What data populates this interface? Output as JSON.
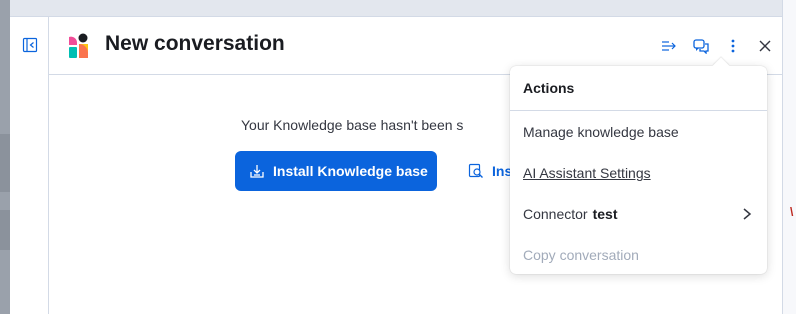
{
  "header": {
    "title": "New conversation"
  },
  "body": {
    "message": "Your Knowledge base hasn't been s",
    "install_label": "Install Knowledge base",
    "inspect_label": "Ins"
  },
  "actions_menu": {
    "title": "Actions",
    "items": [
      {
        "label": "Manage knowledge base"
      },
      {
        "label": "AI Assistant Settings"
      },
      {
        "label": "Connector",
        "value": "test"
      },
      {
        "label": "Copy conversation"
      }
    ]
  },
  "colors": {
    "primary": "#0b64dd",
    "text": "#343741",
    "disabled": "#a2abba",
    "border": "#d3dae6"
  },
  "icons": {
    "rail": "sidebar-collapse-icon",
    "header": [
      "arrow-right-icon",
      "chat-bubbles-icon",
      "vertical-dots-icon",
      "close-icon"
    ],
    "install": "download-tray-icon",
    "inspect": "inspect-icon",
    "connector": "chevron-right-icon"
  }
}
